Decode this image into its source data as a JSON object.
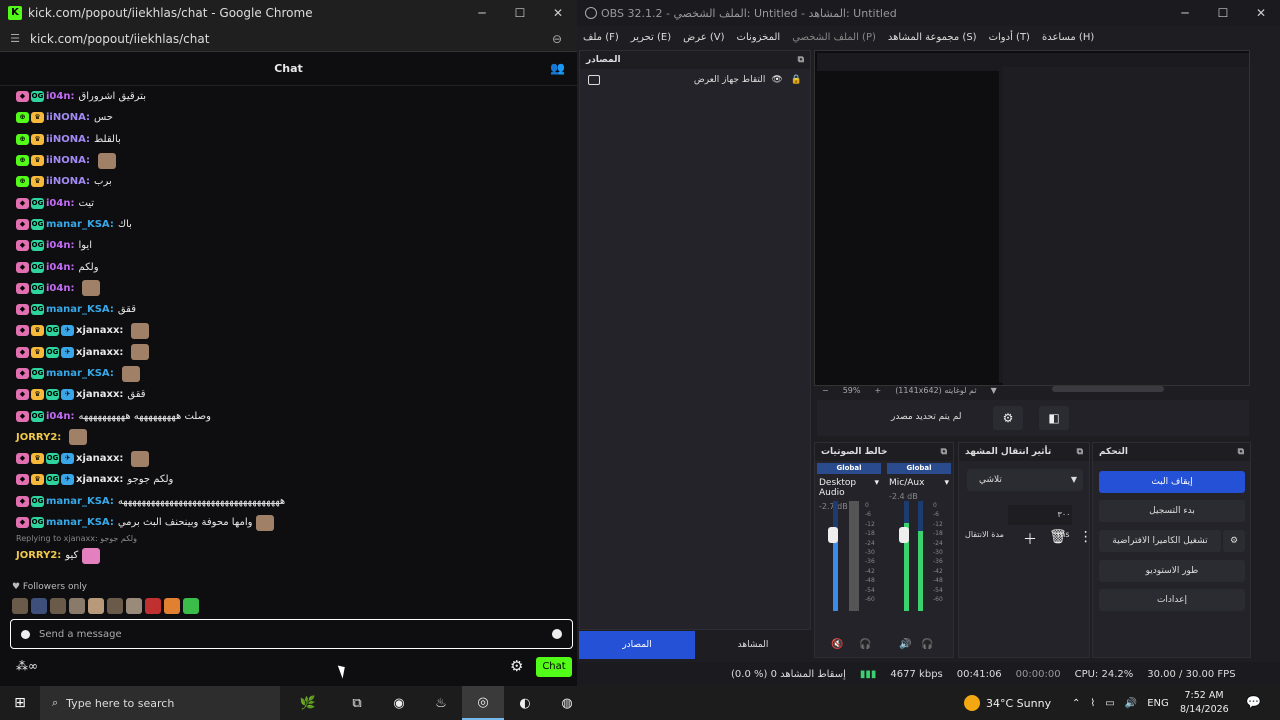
{
  "chrome": {
    "title": "kick.com/popout/iiekhlas/chat - Google Chrome",
    "url": "kick.com/popout/iiekhlas/chat",
    "win_min": "─",
    "win_max": "☐",
    "win_close": "✕"
  },
  "chat": {
    "header": "Chat",
    "messages": [
      {
        "badges": [
          "sub",
          "og"
        ],
        "user": "i04n",
        "color": "#c16cf5",
        "text": "بترقيق اشروراق",
        "emote": false
      },
      {
        "badges": [
          "green",
          "crown"
        ],
        "user": "iiNONA",
        "color": "#a38af5",
        "text": "حس",
        "emote": false
      },
      {
        "badges": [
          "green",
          "crown"
        ],
        "user": "iiNONA",
        "color": "#a38af5",
        "text": "بالقلط",
        "emote": false
      },
      {
        "badges": [
          "green",
          "crown"
        ],
        "user": "iiNONA",
        "color": "#a38af5",
        "text": "",
        "emote": true
      },
      {
        "badges": [
          "green",
          "crown"
        ],
        "user": "iiNONA",
        "color": "#a38af5",
        "text": "برب",
        "emote": false
      },
      {
        "badges": [
          "sub",
          "og"
        ],
        "user": "i04n",
        "color": "#c16cf5",
        "text": "تيت",
        "emote": false
      },
      {
        "badges": [
          "sub",
          "og"
        ],
        "user": "manar_KSA",
        "color": "#38a8e8",
        "text": "باك",
        "emote": false
      },
      {
        "badges": [
          "sub",
          "og"
        ],
        "user": "i04n",
        "color": "#c16cf5",
        "text": "ايوا",
        "emote": false
      },
      {
        "badges": [
          "sub",
          "og"
        ],
        "user": "i04n",
        "color": "#c16cf5",
        "text": "ولكم",
        "emote": false
      },
      {
        "badges": [
          "sub",
          "og"
        ],
        "user": "i04n",
        "color": "#c16cf5",
        "text": "",
        "emote": true
      },
      {
        "badges": [
          "sub",
          "og"
        ],
        "user": "manar_KSA",
        "color": "#38a8e8",
        "text": "ققق",
        "emote": false
      },
      {
        "badges": [
          "sub",
          "crown",
          "og",
          "vip"
        ],
        "user": "xjanaxx",
        "color": "#e8e8e8",
        "text": "",
        "emote": true
      },
      {
        "badges": [
          "sub",
          "crown",
          "og",
          "vip"
        ],
        "user": "xjanaxx",
        "color": "#e8e8e8",
        "text": "",
        "emote": true
      },
      {
        "badges": [
          "sub",
          "og"
        ],
        "user": "manar_KSA",
        "color": "#38a8e8",
        "text": "",
        "emote": true
      },
      {
        "badges": [
          "sub",
          "crown",
          "og",
          "vip"
        ],
        "user": "xjanaxx",
        "color": "#e8e8e8",
        "text": "ققق",
        "emote": false
      },
      {
        "badges": [
          "sub",
          "og"
        ],
        "user": "i04n",
        "color": "#c16cf5",
        "text": "وصلت هههههههههه ههههههههههه",
        "emote": false
      },
      {
        "badges": [],
        "user": "JORRY2",
        "color": "#f1c94b",
        "text": "",
        "emote": true
      },
      {
        "badges": [
          "sub",
          "crown",
          "og",
          "vip"
        ],
        "user": "xjanaxx",
        "color": "#e8e8e8",
        "text": "",
        "emote": true
      },
      {
        "badges": [
          "sub",
          "crown",
          "og",
          "vip"
        ],
        "user": "xjanaxx",
        "color": "#e8e8e8",
        "text": "ولكم جوجو",
        "emote": false
      },
      {
        "badges": [
          "sub",
          "og"
        ],
        "user": "manar_KSA",
        "color": "#38a8e8",
        "text": "هههههههههههههههههههههههههههههههههههه",
        "emote": false
      },
      {
        "badges": [
          "sub",
          "og"
        ],
        "user": "manar_KSA",
        "color": "#38a8e8",
        "text": "وامها محوفة وبينحنف البث برمي",
        "emote": true
      }
    ],
    "reply_to": "Replying to xjanaxx: ولكم جوجو",
    "last_msg": {
      "user": "JORRY2",
      "text": "كيو",
      "color": "#f1c94b"
    },
    "followers_only": "♥ Followers only",
    "input_placeholder": "Send a message",
    "chat_button": "Chat",
    "points_icon": "⁂∞"
  },
  "obs": {
    "title": "OBS 32.1.2 - الملف الشخصي: Untitled - المشاهد: Untitled",
    "menu": [
      "ملف (F)",
      "تحرير (E)",
      "عرض (V)",
      "المخزونات",
      "الملف الشخصي (P)",
      "مجموعة المشاهد (S)",
      "أدوات (T)",
      "مساعدة (H)"
    ],
    "sources_title": "المصادر",
    "source_item": "التقاط جهاز العرض",
    "zoom": "59%",
    "resolution": "(1141x642) ثم لوغايته",
    "no_source": "لم يتم تحديد مصدر",
    "mixer_title": "خالط الصوتيات",
    "mixer": [
      {
        "global": "Global",
        "name": "Desktop Audio",
        "db": "-2.7 dB",
        "level": 0.7
      },
      {
        "global": "Global",
        "name": "Mic/Aux",
        "db": "-2.4 dB",
        "level": 0.8
      }
    ],
    "scale": [
      "0",
      "-6",
      "-12",
      "-18",
      "-24",
      "-30",
      "-36",
      "-42",
      "-48",
      "-54",
      "-60"
    ],
    "transition_title": "تأثير انتقال المشهد",
    "transition_select": "تلاشي",
    "duration_label": "مدة الانتقال",
    "duration_value": "٣٠٠ ms",
    "controls_title": "التحكم",
    "controls": [
      "إيقاف البث",
      "بدء التسجيل",
      "تشغيل الكاميرا الافتراضية",
      "طور الاستوديو",
      "إعدادات"
    ],
    "tabs": [
      "المصادر",
      "المشاهد"
    ],
    "status": {
      "dropped": "(0.0 %) 0 إسقاط المشاهد",
      "bitrate": "4677 kbps",
      "stream_time": "00:41:06",
      "rec_time": "00:00:00",
      "cpu": "CPU: 24.2%",
      "fps": "30.00 / 30.00 FPS"
    }
  },
  "taskbar": {
    "search": "Type here to search",
    "weather": "34°C  Sunny",
    "lang": "ENG",
    "time": "7:52 AM",
    "date": "8/14/2026"
  }
}
